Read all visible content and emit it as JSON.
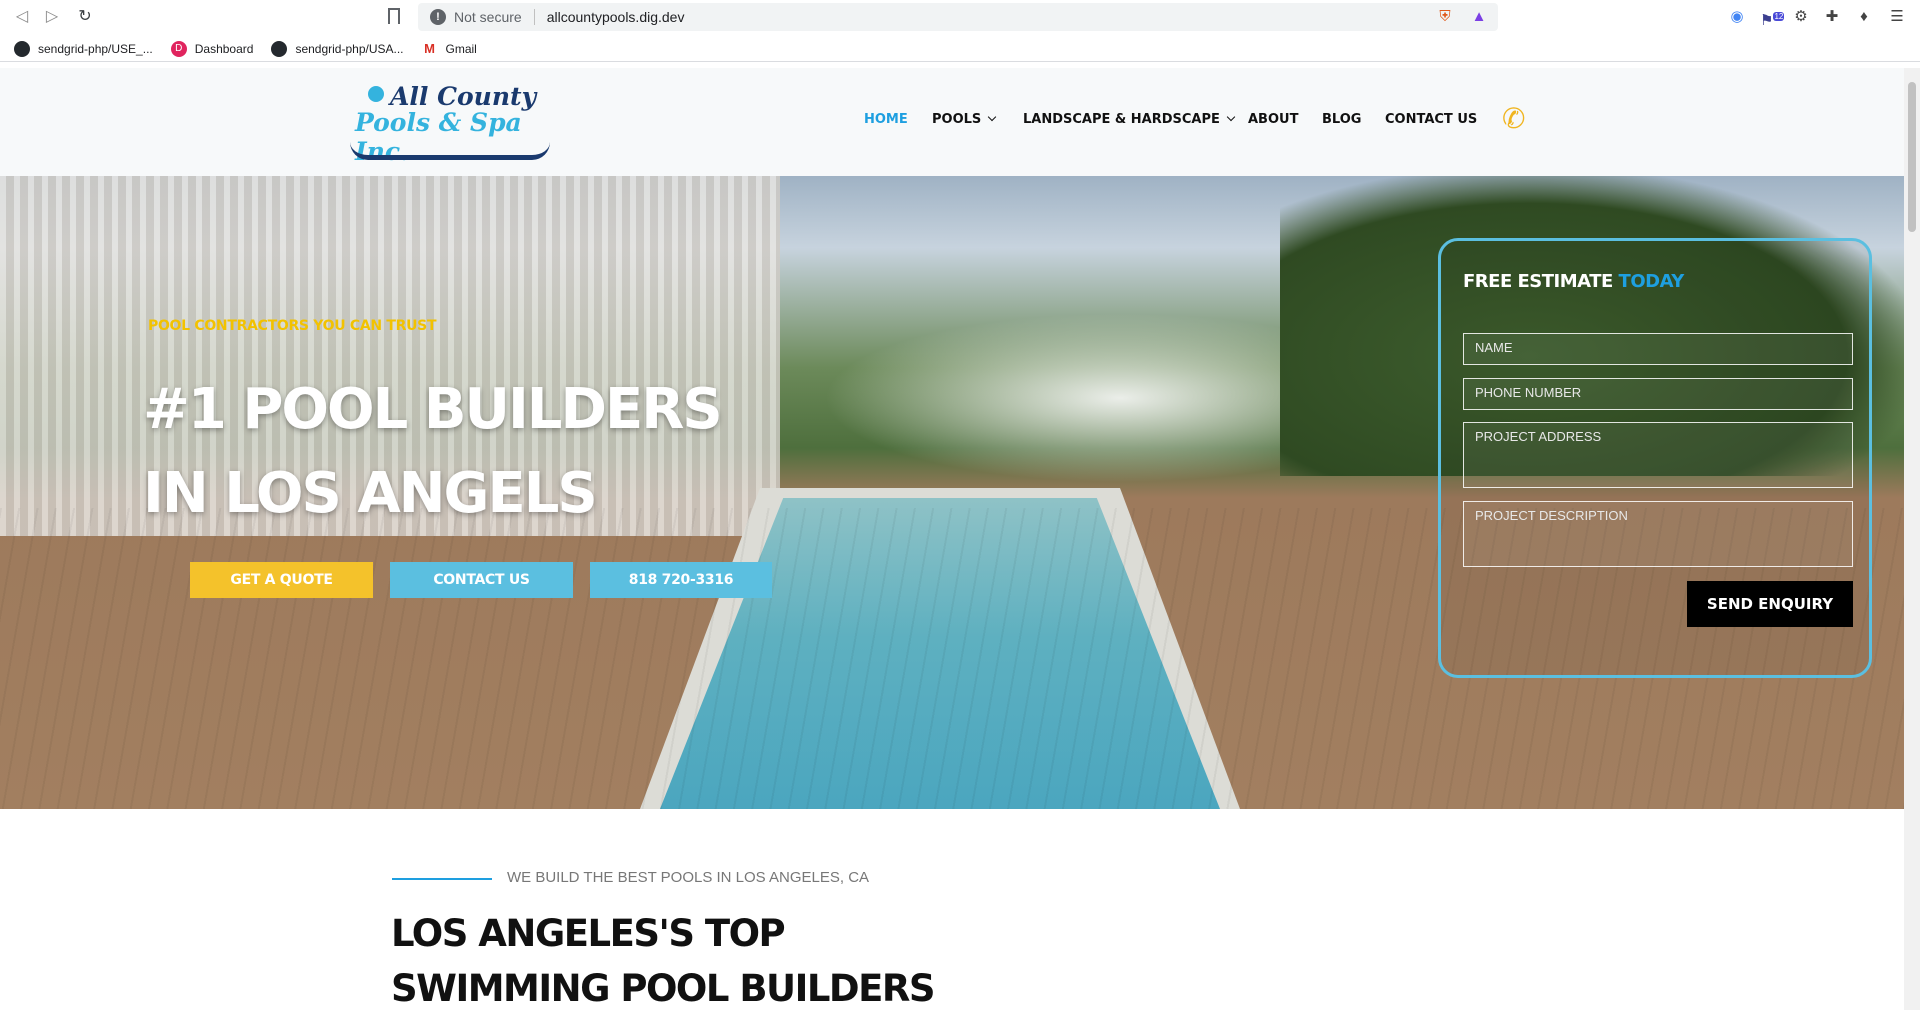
{
  "browser": {
    "security_label": "Not secure",
    "url": "allcountypools.dig.dev",
    "extension_badge": "12",
    "bookmarks": [
      {
        "label": "sendgrid-php/USE_...",
        "icon": "github-icon"
      },
      {
        "label": "Dashboard",
        "icon": "dashboard-icon"
      },
      {
        "label": "sendgrid-php/USA...",
        "icon": "github-icon"
      },
      {
        "label": "Gmail",
        "icon": "gmail-icon"
      }
    ]
  },
  "header": {
    "logo_line1": "All County",
    "logo_line2": "Pools & Spa Inc.",
    "nav": [
      {
        "label": "HOME",
        "active": true
      },
      {
        "label": "POOLS",
        "dropdown": true
      },
      {
        "label": "LANDSCAPE & HARDSCAPE",
        "dropdown": true
      },
      {
        "label": "ABOUT"
      },
      {
        "label": "BLOG"
      },
      {
        "label": "CONTACT US"
      }
    ],
    "phone_icon": "phone-icon"
  },
  "hero": {
    "tagline": "POOL CONTRACTORS YOU CAN TRUST",
    "headline_line1": "#1 POOL BUILDERS",
    "headline_line2": "IN LOS ANGELS",
    "buttons": {
      "quote": "GET A QUOTE",
      "contact": "CONTACT US",
      "phone": "818 720-3316"
    }
  },
  "form": {
    "title_main": "FREE ESTIMATE ",
    "title_accent": "TODAY",
    "name_placeholder": "NAME",
    "phone_placeholder": "PHONE NUMBER",
    "address_placeholder": "PROJECT ADDRESS",
    "description_placeholder": "PROJECT DESCRIPTION",
    "submit_label": "SEND ENQUIRY"
  },
  "section": {
    "subtitle": "WE BUILD THE BEST POOLS IN LOS ANGELES, CA",
    "title_line1": "LOS ANGELES'S TOP",
    "title_line2": "SWIMMING POOL BUILDERS"
  },
  "colors": {
    "accent_blue": "#1e9fe0",
    "button_blue": "#5bbfe0",
    "button_yellow": "#f4c22b",
    "tagline_yellow": "#f2c200"
  }
}
